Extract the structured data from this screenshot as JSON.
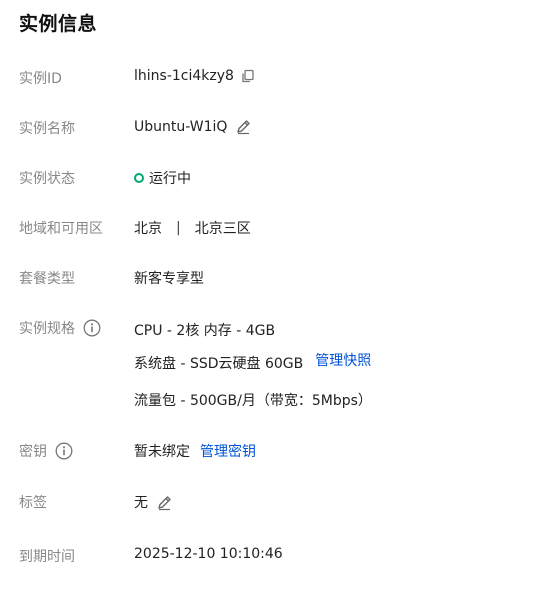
{
  "title": "实例信息",
  "rows": {
    "instance_id": {
      "label": "实例ID",
      "value": "lhins-1ci4kzy8"
    },
    "instance_name": {
      "label": "实例名称",
      "value": "Ubuntu-W1iQ"
    },
    "instance_status": {
      "label": "实例状态",
      "value": "运行中",
      "status_color": "#00a870"
    },
    "region": {
      "label": "地域和可用区",
      "region": "北京",
      "separator": "|",
      "zone": "北京三区"
    },
    "package_type": {
      "label": "套餐类型",
      "value": "新客专享型"
    },
    "spec": {
      "label": "实例规格",
      "cpu_mem": "CPU - 2核 内存 - 4GB",
      "disk": "系统盘 - SSD云硬盘 60GB",
      "disk_link": "管理快照",
      "traffic": "流量包 - 500GB/月（带宽：5Mbps）"
    },
    "key": {
      "label": "密钥",
      "value": "暂未绑定",
      "link": "管理密钥"
    },
    "tags": {
      "label": "标签",
      "value": "无"
    },
    "expire": {
      "label": "到期时间",
      "value": "2025-12-10 10:10:46"
    }
  },
  "colors": {
    "link": "#0052d9",
    "label": "#888888",
    "value": "#222222",
    "running": "#00a870"
  },
  "icons": [
    "copy-icon",
    "edit-icon",
    "info-icon"
  ]
}
